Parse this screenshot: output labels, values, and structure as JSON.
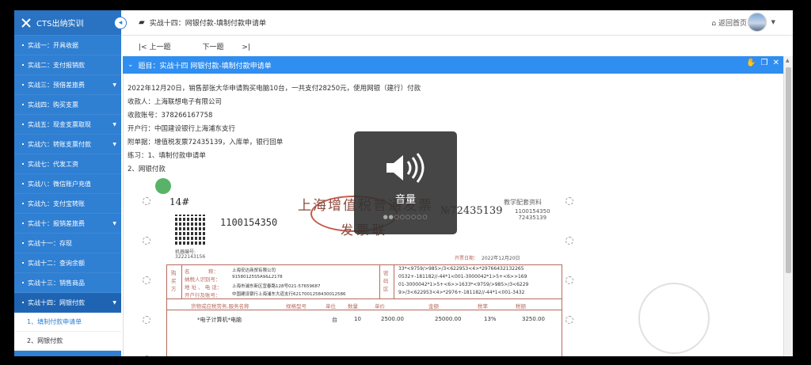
{
  "app": {
    "title": "CTS出纳实训"
  },
  "sidebar": {
    "items": [
      {
        "label": "实战一：开具收据",
        "caret": false
      },
      {
        "label": "实战二：支付报销款",
        "caret": false
      },
      {
        "label": "实战三：预借差旅费",
        "caret": true
      },
      {
        "label": "实战四：购买支票",
        "caret": false
      },
      {
        "label": "实战五：现金支票取现",
        "caret": true
      },
      {
        "label": "实战六：转账支票付款",
        "caret": true
      },
      {
        "label": "实战七：代发工资",
        "caret": false
      },
      {
        "label": "实战八：微信账户充值",
        "caret": false
      },
      {
        "label": "实战九：支付宝转账",
        "caret": false
      },
      {
        "label": "实战十：报销差旅费",
        "caret": true
      },
      {
        "label": "实战十一：存现",
        "caret": false
      },
      {
        "label": "实战十二：查询余额",
        "caret": false
      },
      {
        "label": "实战十三：销售商品",
        "caret": false
      },
      {
        "label": "实战十四：网银付款",
        "caret": true
      }
    ],
    "sub_items": [
      "1、填制付款申请单",
      "2、网银付款"
    ]
  },
  "topbar": {
    "breadcrumb": "实战十四：网银付款-填制付款申请单",
    "home": "返回首页"
  },
  "pager": {
    "prev": "上一题",
    "next": "下一题"
  },
  "question": {
    "header": "题目：实战十四   网银付款-填制付款申请单"
  },
  "content": {
    "lines": [
      "2022年12月20日，销售部张大华申请购买电脑10台，一共支付28250元，使用网银（建行）付款",
      "收款人：上海联想电子有限公司",
      "收款账号：378266167758",
      "开户行：中国建设银行上海浦东支行",
      "附单据：增值税发票72435139，入库单，银行回单",
      "练习：1、填制付款申请单",
      "2、网银付款"
    ]
  },
  "invoice": {
    "seq": "14#",
    "title": "上海增值税普通发票",
    "sub": "发票联",
    "code": "1100154350",
    "no": "№72435139",
    "copy_label": "教学配套资料",
    "right_code": "1100154350",
    "right_no": "72435139",
    "machine_label": "机器编号:",
    "machine_no": "3222143156",
    "date_label": "开票日期：",
    "date": "2022年12月20日",
    "buyer_name": "上海安达商贸有限公司",
    "buyer_tax": "91580125S5A9&L2178",
    "buyer_addr": "上海市浦东新区宜春路128号021-57659687",
    "buyer_bank": "中国建设银行上海浦东大道支行6217001258430012586",
    "cipher": [
      "33*<9759/>985>/3<622953<4>*29766432132265",
      "0532+-181182//-44*1<001-3000042*1>5+<6>>169",
      "01-3000042*1>5+<6>>1633*<9759/>985>/3<6229",
      "9>/3<622953<4>*2976+-181182//-44*1<001-3432"
    ],
    "headers": [
      "货物或应税劳务,服务名称",
      "规格型号",
      "单位",
      "数量",
      "单价",
      "金额",
      "税率",
      "税额"
    ],
    "row": [
      "*电子计算机*电脑",
      "",
      "台",
      "10",
      "2500.00",
      "25000.00",
      "13%",
      "3250.00"
    ],
    "side_labels": [
      "购",
      "买",
      "方",
      "密",
      "码",
      "区"
    ],
    "field_labels": [
      "名",
      "称：",
      "纳税人识别号：",
      "地 址 、 电 话：",
      "开户行及账号："
    ]
  },
  "overlay": {
    "label": "音量"
  }
}
